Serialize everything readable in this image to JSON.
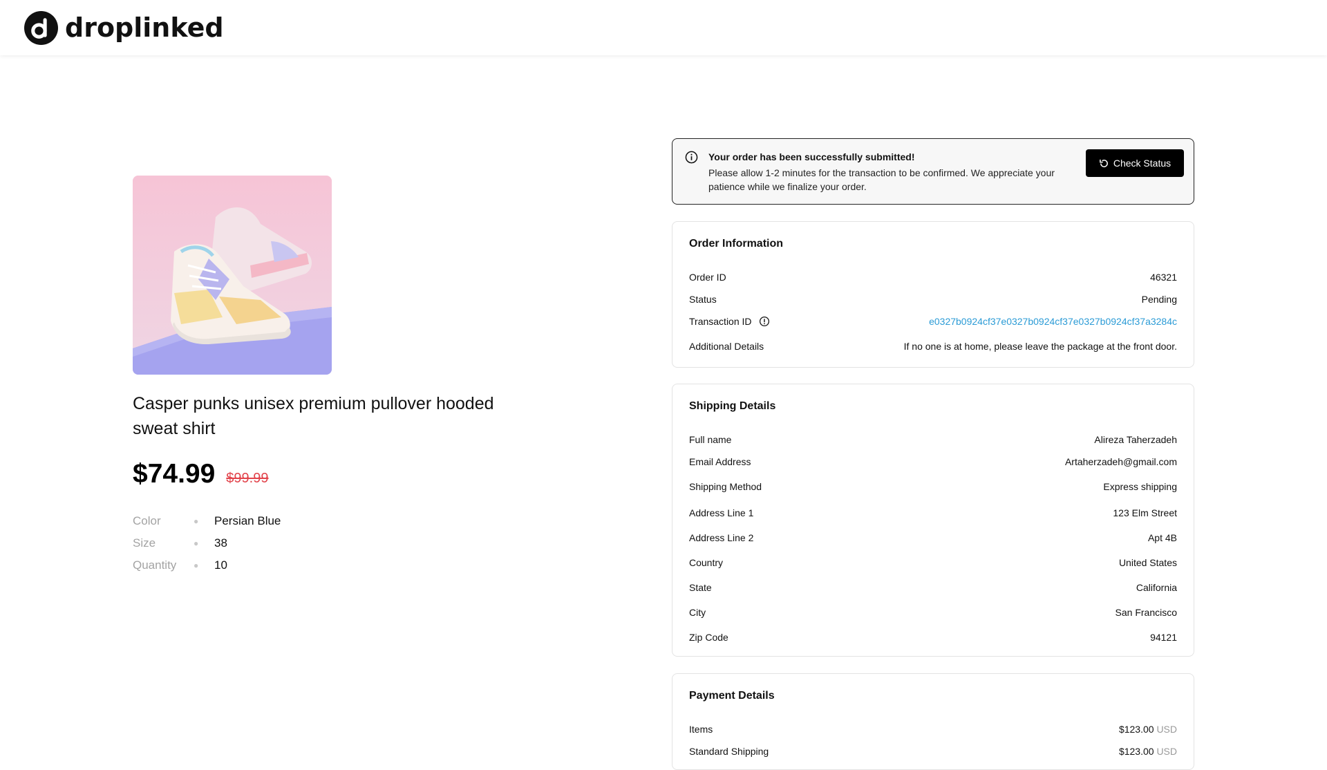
{
  "brand": {
    "name": "droplinked"
  },
  "product": {
    "title": "Casper punks unisex premium pullover hooded sweat shirt",
    "price": "$74.99",
    "old_price": "$99.99",
    "attributes": [
      {
        "label": "Color",
        "value": "Persian Blue"
      },
      {
        "label": "Size",
        "value": "38"
      },
      {
        "label": "Quantity",
        "value": "10"
      }
    ]
  },
  "alert": {
    "title": "Your order has been successfully submitted!",
    "text": "Please allow 1-2 minutes for the transaction to be confirmed. We appreciate your patience while we finalize your order.",
    "button_label": "Check Status"
  },
  "order_info": {
    "title": "Order Information",
    "rows": [
      {
        "label": "Order ID",
        "value": "46321"
      },
      {
        "label": "Status",
        "value": "Pending"
      },
      {
        "label": "Transaction ID",
        "value": "e0327b0924cf37e0327b0924cf37e0327b0924cf37a3284c"
      },
      {
        "label": "Additional Details",
        "value": "If no one is at home, please leave the package at the front door."
      }
    ]
  },
  "shipping": {
    "title": "Shipping Details",
    "rows": [
      {
        "label": "Full name",
        "value": "Alireza Taherzadeh"
      },
      {
        "label": "Email Address",
        "value": "Artaherzadeh@gmail.com"
      },
      {
        "label": "Shipping Method",
        "value": "Express shipping"
      },
      {
        "label": "Address Line 1",
        "value": "123 Elm Street"
      },
      {
        "label": "Address Line 2",
        "value": "Apt 4B"
      },
      {
        "label": "Country",
        "value": "United States"
      },
      {
        "label": "State",
        "value": "California"
      },
      {
        "label": "City",
        "value": "San Francisco"
      },
      {
        "label": "Zip Code",
        "value": "94121"
      }
    ]
  },
  "payment": {
    "title": "Payment Details",
    "rows": [
      {
        "label": "Items",
        "amount": "$123.00",
        "unit": "USD"
      },
      {
        "label": "Standard Shipping",
        "amount": "$123.00",
        "unit": "USD"
      }
    ]
  },
  "colors": {
    "accent_link": "#2b9bd6",
    "old_price": "#e2434b",
    "button_bg": "#000000"
  }
}
